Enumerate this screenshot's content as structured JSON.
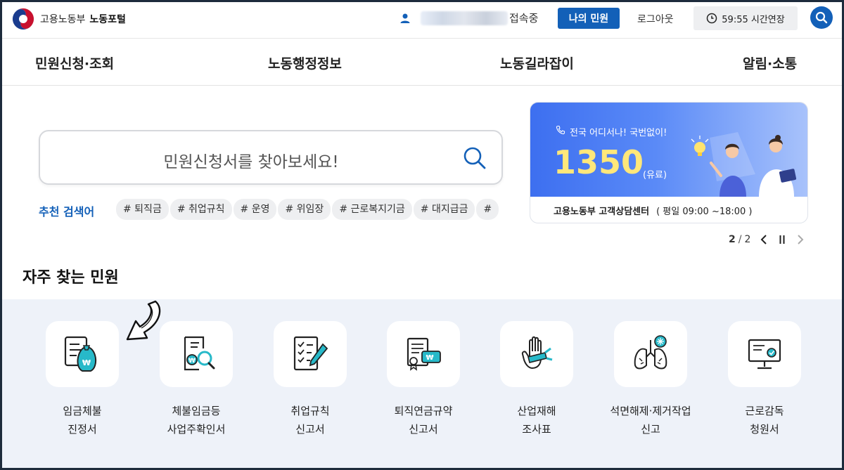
{
  "header": {
    "ministry": "고용노동부",
    "portal": "노동포털",
    "status": "접속중",
    "my_button": "나의 민원",
    "logout": "로그아웃",
    "timer": "59:55 시간연장"
  },
  "nav": {
    "items": [
      "민원신청·조회",
      "노동행정정보",
      "노동길라잡이",
      "알림·소통"
    ]
  },
  "search": {
    "placeholder": "민원신청서를 찾아보세요!",
    "recommend_label": "추천 검색어",
    "tags": [
      "# 퇴직금",
      "# 취업규칙",
      "# 운영",
      "# 위임장",
      "# 근로복지기금",
      "# 대지급금",
      "# "
    ]
  },
  "banner": {
    "tagline": "전국 어디서나! 국번없이!",
    "number": "1350",
    "paid": "(유료)",
    "center": "고용노동부 고객상담센터",
    "hours": "( 평일 09:00 ~18:00 )"
  },
  "pager": {
    "current": "2",
    "total": "2"
  },
  "frequent": {
    "title": "자주 찾는 민원",
    "items": [
      {
        "line1": "임금체불",
        "line2": "진정서",
        "icon": "wage-arrears-document-icon"
      },
      {
        "line1": "체불임금등",
        "line2": "사업주확인서",
        "icon": "document-magnifier-icon"
      },
      {
        "line1": "취업규칙",
        "line2": "신고서",
        "icon": "checklist-pen-icon"
      },
      {
        "line1": "퇴직연금규약",
        "line2": "신고서",
        "icon": "certificate-scroll-icon"
      },
      {
        "line1": "산업재해",
        "line2": "조사표",
        "icon": "injured-hand-icon"
      },
      {
        "line1": "석면해제·제거작업",
        "line2": "신고",
        "icon": "lungs-icon"
      },
      {
        "line1": "근로감독",
        "line2": "청원서",
        "icon": "monitor-check-icon"
      }
    ]
  },
  "colors": {
    "primary": "#1360b8",
    "teal": "#26b8c8",
    "banner_gradient_start": "#3d6ff0",
    "section_bg": "#eef2f9"
  }
}
